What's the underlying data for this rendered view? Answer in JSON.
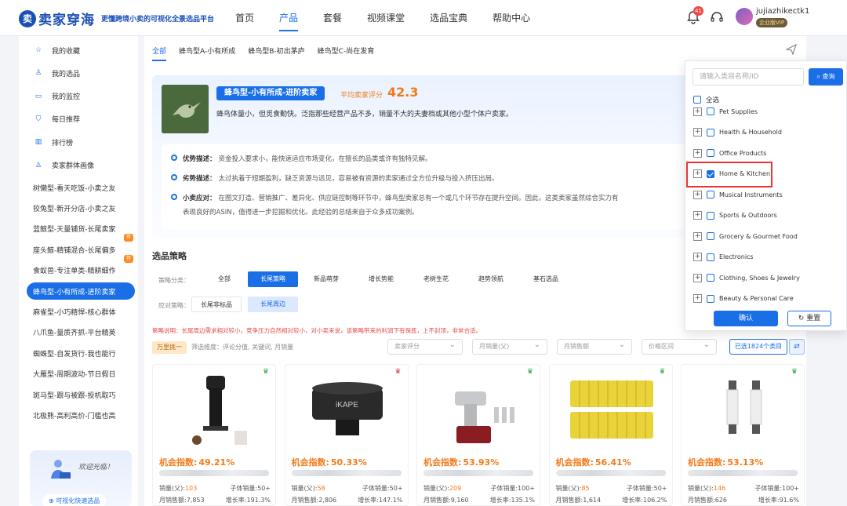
{
  "header": {
    "logo_mark": "卖",
    "logo_text": "卖家穿海",
    "logo_subtitle": "更懂跨境小卖的可视化全景选品平台",
    "nav": [
      "首页",
      "产品",
      "套餐",
      "视频课堂",
      "选品宝典",
      "帮助中心"
    ],
    "active_nav": "产品",
    "notification_count": "41",
    "username": "jujiazhikectk1",
    "vip_label": "企业版VIP"
  },
  "sidebar": {
    "icon_items": [
      {
        "label": "我的收藏",
        "icon": "star-icon"
      },
      {
        "label": "我的选品",
        "icon": "user-icon"
      },
      {
        "label": "我的监控",
        "icon": "monitor-icon"
      },
      {
        "label": "每日推荐",
        "icon": "shield-icon"
      },
      {
        "label": "排行榜",
        "icon": "bar-chart-icon"
      },
      {
        "label": "卖家群体画像",
        "icon": "group-icon"
      }
    ],
    "type_items": [
      {
        "label": "树懒型-看天吃饭-小卖之友",
        "badge": ""
      },
      {
        "label": "狡兔型-新开分店-小卖之友",
        "badge": ""
      },
      {
        "label": "蓝鲸型-天量铺货-长尾卖家",
        "badge": ""
      },
      {
        "label": "座头鲸-精铺混合-长尾偏多",
        "badge": "荐"
      },
      {
        "label": "食蚁兽-专注单类-精耕细作",
        "badge": "荐"
      },
      {
        "label": "蜂鸟型-小有所成-进阶卖家",
        "badge": ""
      },
      {
        "label": "麻雀型-小巧精悍-核心群体",
        "badge": ""
      },
      {
        "label": "八爪鱼-量质齐抓-平台精英",
        "badge": ""
      },
      {
        "label": "蜘蛛型-自发货行-我也能行",
        "badge": ""
      },
      {
        "label": "大雁型-周期波动-节日假日",
        "badge": ""
      },
      {
        "label": "斑马型-跟与被跟-投机取巧",
        "badge": ""
      },
      {
        "label": "北极熊-高利高价-门槛也高",
        "badge": ""
      }
    ],
    "active_item": "蜂鸟型-小有所成-进阶卖家",
    "promo_text": "欢迎光临！",
    "promo_link": "可视化快速选品"
  },
  "main": {
    "tabs": [
      "全部",
      "蜂鸟型A-小有所成",
      "蜂鸟型B-初出茅庐",
      "蜂鸟型C-尚在发育"
    ],
    "active_tab": "全部",
    "type_card": {
      "title": "蜂鸟型-小有所成-进阶卖家",
      "score_label": "平均卖家评分",
      "score": "42.3",
      "desc": "蜂鸟体量小，但觅食勤快。泛指那些经营产品不多，销量不大的夫妻档或其他小型个体户卖家。",
      "details": [
        {
          "label": "优势描述：",
          "text": "资金投入要求小，能快速适应市场变化，在擅长的品类或许有独特见解。"
        },
        {
          "label": "劣势描述：",
          "text": "太过执着于短期盈利，缺乏资源与远见，容易被有资源的卖家通过全方位升级与投入挤压出局。"
        },
        {
          "label": "小卖应对：",
          "text": "在图文打造、营销推广、差异化、供应链控制等环节中，蜂鸟型卖家总有一个或几个环节存在提升空间。因此，这类卖家虽然综合实力有",
          "text2": "表现良好的ASIN，值得进一步挖掘和优化。此经验的总结来自于众多成功案例。"
        }
      ]
    },
    "strategy": {
      "title": "选品策略",
      "class_label": "策略分类：",
      "classes": [
        "全部",
        "长尾策略",
        "新品萌芽",
        "增长势能",
        "老树生花",
        "趋势领航",
        "基石选品"
      ],
      "active_class": "长尾策略",
      "resp_label": "应对策略：",
      "responses": [
        "长尾非标品",
        "长尾周边"
      ],
      "active_response": "长尾周边",
      "note": "策略说明：长尾周边需求相对较小，竞争压力自然相对较小，对小卖来说，该策略带来的利润下有保底，上不封顶，非常合适。"
    },
    "filters": {
      "tag": "万里挑一",
      "desc": "筛选维度：评论分值, 关键词, 月销量",
      "selects": [
        "卖家评分",
        "月销量(父)",
        "月销售额",
        "价格区间"
      ],
      "selected_categories": "已选1824个类目"
    },
    "products": [
      {
        "opp_label": "机会指数:",
        "opp": "49.21%",
        "sales_label": "销量(父):",
        "sales": "103",
        "child_sales": "子体销量:50+",
        "revenue": "月销售额:7,853",
        "growth": "增长率:191.3%",
        "crown_color": "#27a745"
      },
      {
        "opp_label": "机会指数:",
        "opp": "50.33%",
        "sales_label": "销量(父):",
        "sales": "58",
        "child_sales": "子体销量:50+",
        "revenue": "月销售额:2,806",
        "growth": "增长率:147.1%",
        "crown_color": "#e03a3a"
      },
      {
        "opp_label": "机会指数:",
        "opp": "53.93%",
        "sales_label": "销量(父):",
        "sales": "209",
        "child_sales": "子体销量:100+",
        "revenue": "月销售额:9,160",
        "growth": "增长率:135.1%",
        "crown_color": "#27a745"
      },
      {
        "opp_label": "机会指数:",
        "opp": "56.41%",
        "sales_label": "销量(父):",
        "sales": "85",
        "child_sales": "子体销量:50+",
        "revenue": "月销售额:1,614",
        "growth": "增长率:106.2%",
        "crown_color": "#27a745"
      },
      {
        "opp_label": "机会指数:",
        "opp": "53.13%",
        "sales_label": "销量(父):",
        "sales": "146",
        "child_sales": "子体销量:100+",
        "revenue": "月销售额:626",
        "growth": "增长率:91.6%",
        "crown_color": "#27a745"
      }
    ]
  },
  "category_dropdown": {
    "placeholder": "请输入类目名称/ID",
    "search_label": "查询",
    "all_label": "全选",
    "categories": [
      {
        "name": "Pet Supplies",
        "checked": false
      },
      {
        "name": "Health & Household",
        "checked": false
      },
      {
        "name": "Office Products",
        "checked": false
      },
      {
        "name": "Home & Kitchen",
        "checked": true
      },
      {
        "name": "Musical Instruments",
        "checked": false
      },
      {
        "name": "Sports & Outdoors",
        "checked": false
      },
      {
        "name": "Grocery & Gourmet Food",
        "checked": false
      },
      {
        "name": "Electronics",
        "checked": false
      },
      {
        "name": "Clothing, Shoes & Jewelry",
        "checked": false
      },
      {
        "name": "Beauty & Personal Care",
        "checked": false
      }
    ],
    "confirm_label": "确认",
    "reset_label": "重置"
  },
  "colors": {
    "accent": "#1a6fe6",
    "brand": "#1a4fb5",
    "highlight": "#f07a1a",
    "warning": "#e34b4b"
  }
}
